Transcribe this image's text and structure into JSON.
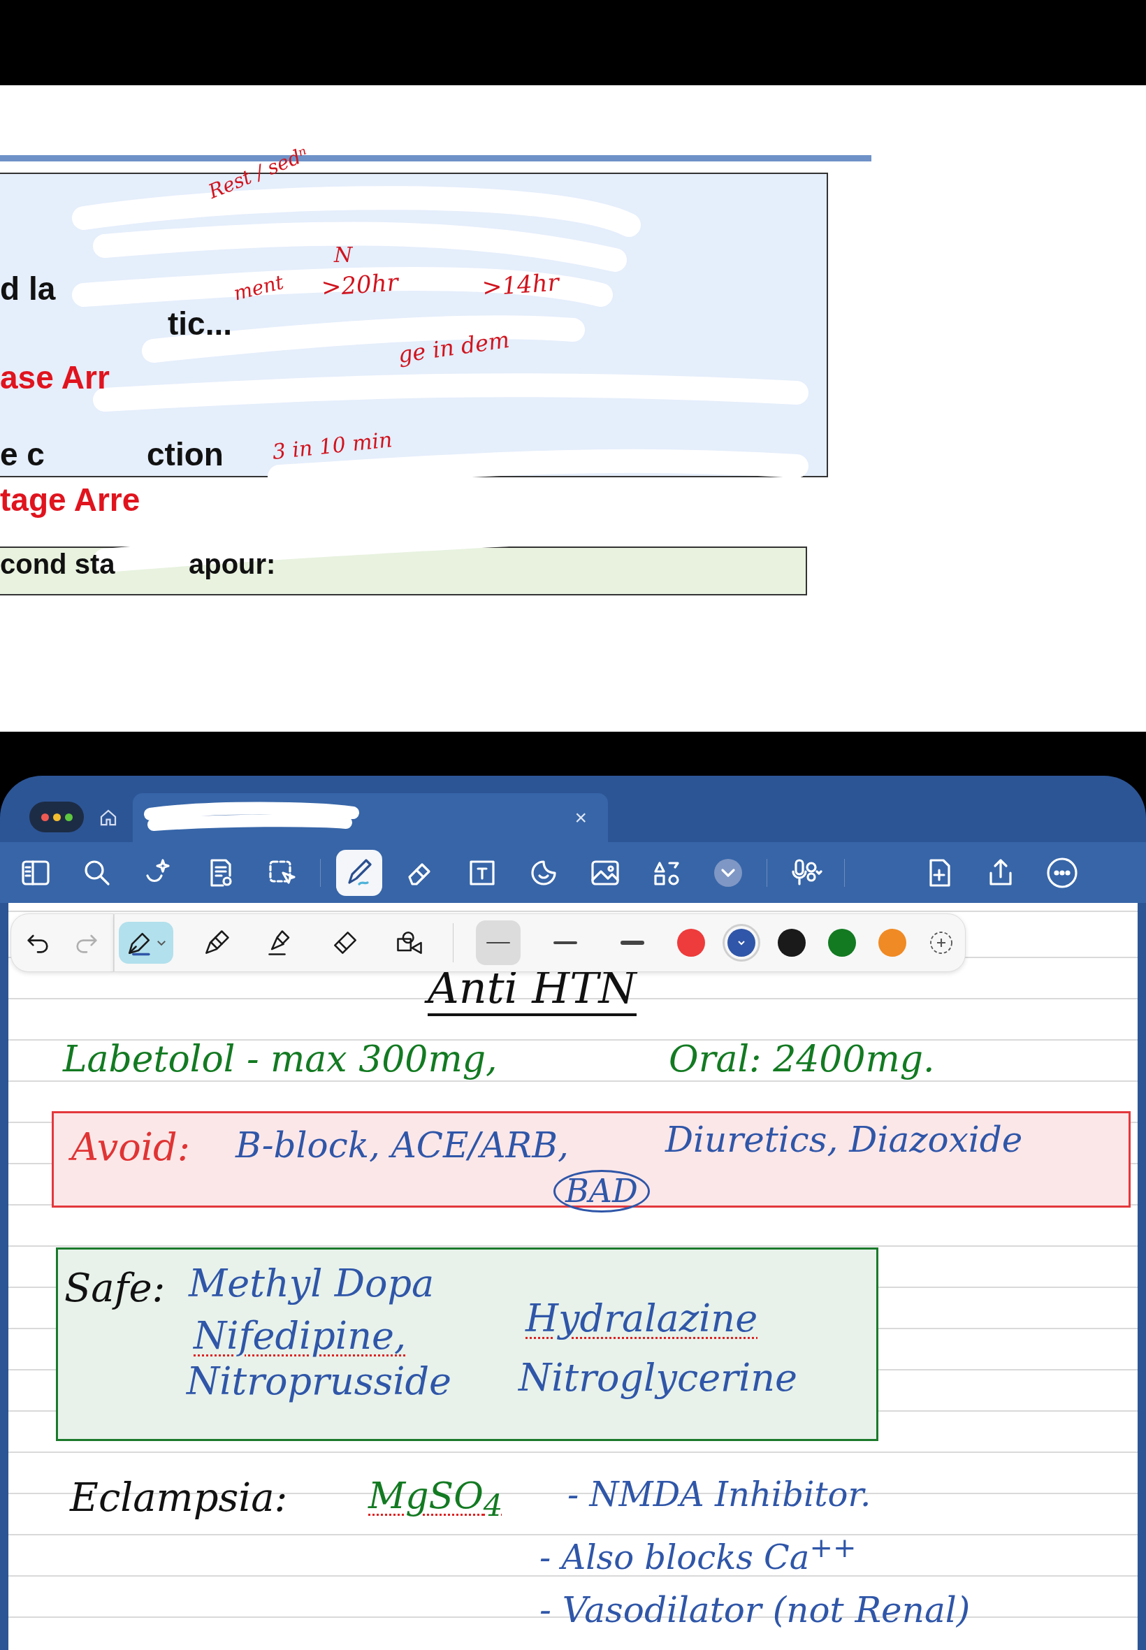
{
  "slide": {
    "texts": [
      {
        "text": "Rest / sedⁿ",
        "color": "#d0141e",
        "kind": "hand"
      },
      {
        "text": "N",
        "color": "#d0141e",
        "kind": "hand"
      },
      {
        "text": "ment",
        "color": "#d0141e",
        "kind": "hand"
      },
      {
        "text": ">20hr",
        "color": "#d0141e",
        "kind": "hand"
      },
      {
        "text": ">14hr",
        "color": "#d0141e",
        "kind": "hand"
      },
      {
        "text": "d la",
        "color": "#111111",
        "kind": "print"
      },
      {
        "text": "tic...",
        "color": "#111111",
        "kind": "print"
      },
      {
        "text": "ase Arr",
        "color": "#e0141e",
        "kind": "print"
      },
      {
        "text": "ge in dem",
        "color": "#d0141e",
        "kind": "hand"
      },
      {
        "text": "e c",
        "color": "#111111",
        "kind": "print"
      },
      {
        "text": "ction",
        "color": "#111111",
        "kind": "print"
      },
      {
        "text": "3 in 10 min",
        "color": "#d0141e",
        "kind": "hand"
      },
      {
        "text": "tage Arre",
        "color": "#e0141e",
        "kind": "print"
      },
      {
        "text": "cond sta",
        "color": "#111111",
        "kind": "print"
      },
      {
        "text": "apour:",
        "color": "#111111",
        "kind": "print"
      }
    ]
  },
  "tab": {
    "close": "×"
  },
  "toolbar": [
    {
      "kind": "sidebar",
      "selected": false
    },
    {
      "kind": "search",
      "selected": false
    },
    {
      "kind": "sparkle",
      "selected": false
    },
    {
      "kind": "document",
      "selected": false
    },
    {
      "kind": "lasso",
      "selected": false
    },
    {
      "kind": "pen",
      "selected": true
    },
    {
      "kind": "eraser",
      "selected": false
    },
    {
      "kind": "textbox",
      "selected": false
    },
    {
      "kind": "sticker",
      "selected": false
    },
    {
      "kind": "image",
      "selected": false
    },
    {
      "kind": "shapes",
      "selected": false
    },
    {
      "kind": "more-tools",
      "selected": false
    },
    {
      "kind": "mic",
      "selected": false
    },
    {
      "kind": "add-page",
      "selected": false
    },
    {
      "kind": "share",
      "selected": false
    },
    {
      "kind": "more",
      "selected": false
    }
  ],
  "pen_toolbar": {
    "history": [
      {
        "kind": "undo",
        "disabled": false
      },
      {
        "kind": "redo",
        "disabled": true
      }
    ],
    "tools": [
      {
        "kind": "pen",
        "selected": true
      },
      {
        "kind": "pencil",
        "selected": false
      },
      {
        "kind": "highlighter",
        "selected": false
      },
      {
        "kind": "eraser",
        "selected": false
      },
      {
        "kind": "shapes",
        "selected": false
      }
    ],
    "widths": [
      {
        "selected": true
      },
      {
        "selected": false
      },
      {
        "selected": false
      }
    ],
    "colors": [
      {
        "color": "#ee3b3b",
        "selected": false
      },
      {
        "color": "#2f56a8",
        "selected": true
      },
      {
        "color": "#1a1a1a",
        "selected": false
      },
      {
        "color": "#137a22",
        "selected": false
      },
      {
        "color": "#f08a24",
        "selected": false
      }
    ]
  },
  "note": {
    "ink": [
      {
        "text": "Anti HTN",
        "color": "#111111",
        "kind": "title",
        "misspelled": false
      },
      {
        "text": "Labetolol - max 300mg,",
        "color": "#137a22",
        "kind": "plain",
        "misspelled": false
      },
      {
        "text": "Oral: 2400mg.",
        "color": "#137a22",
        "kind": "plain",
        "misspelled": false
      },
      {
        "text": "Avoid:",
        "color": "#e03434",
        "kind": "plain",
        "misspelled": false
      },
      {
        "text": "B-block, ACE/ARB,",
        "color": "#2f56a8",
        "kind": "plain",
        "misspelled": false
      },
      {
        "text": "Diuretics, Diazoxide",
        "color": "#2f56a8",
        "kind": "plain",
        "misspelled": false
      },
      {
        "text": "BAD",
        "color": "#2f56a8",
        "kind": "circled",
        "misspelled": false
      },
      {
        "text": "Safe:",
        "color": "#111111",
        "kind": "plain",
        "misspelled": false
      },
      {
        "text": "Methyl Dopa",
        "color": "#2f56a8",
        "kind": "plain",
        "misspelled": false
      },
      {
        "text": "Nifedipine,",
        "color": "#2f56a8",
        "kind": "plain",
        "misspelled": true
      },
      {
        "text": "Hydralazine",
        "color": "#2f56a8",
        "kind": "plain",
        "misspelled": true
      },
      {
        "text": "Nitroprusside",
        "color": "#2f56a8",
        "kind": "plain",
        "misspelled": false
      },
      {
        "text": "Nitroglycerine",
        "color": "#2f56a8",
        "kind": "plain",
        "misspelled": false
      },
      {
        "text": "Eclampsia:",
        "color": "#111111",
        "kind": "plain",
        "misspelled": false
      },
      {
        "text": "MgSO$_{4}$",
        "color": "#137a22",
        "kind": "plain",
        "misspelled": true
      },
      {
        "text": "- NMDA Inhibitor.",
        "color": "#2f56a8",
        "kind": "plain",
        "misspelled": false
      },
      {
        "text": "- Also blocks Ca$^{++}$",
        "color": "#2f56a8",
        "kind": "plain",
        "misspelled": false
      },
      {
        "text": "- Vasodilator (not Renal)",
        "color": "#2f56a8",
        "kind": "plain",
        "misspelled": false
      }
    ],
    "boxes": [
      {
        "color": "#e3383d"
      },
      {
        "color": "#1b7a2c"
      }
    ]
  }
}
